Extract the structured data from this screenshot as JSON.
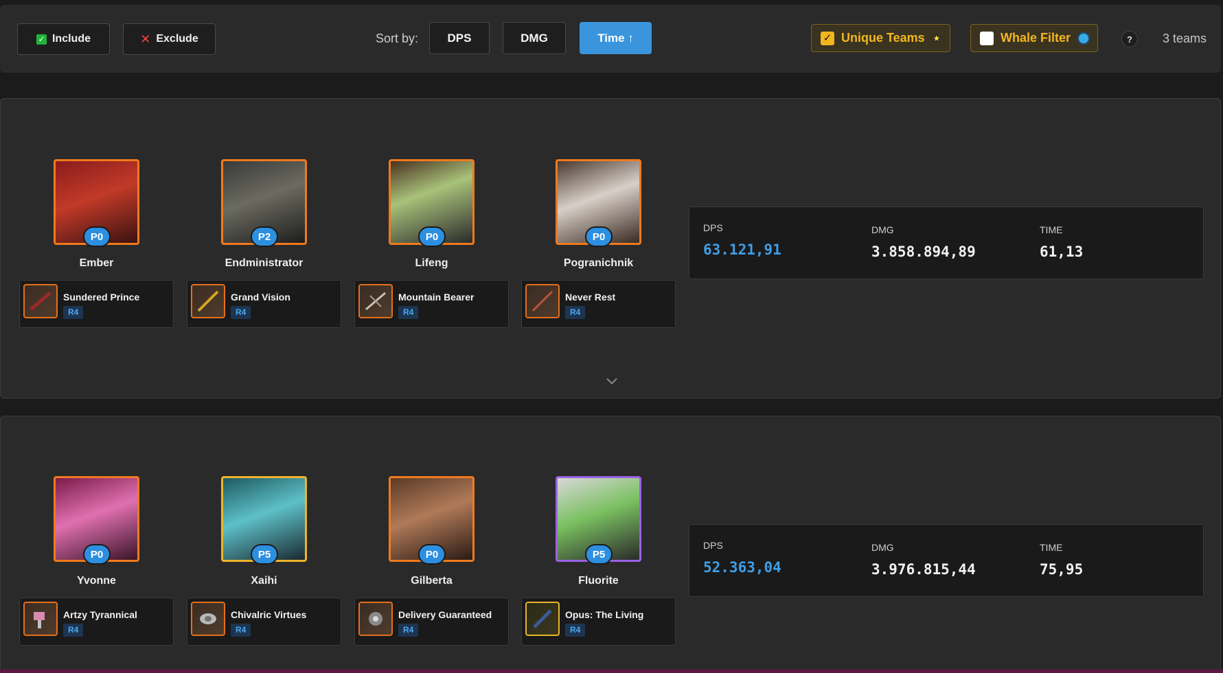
{
  "toolbar": {
    "include_label": "Include",
    "exclude_label": "Exclude",
    "sort_label": "Sort by:",
    "sort_options": [
      "DPS",
      "DMG",
      "Time ↑"
    ],
    "active_sort": "Time ↑",
    "unique_teams_label": "Unique Teams",
    "unique_teams_checked": true,
    "whale_filter_label": "Whale Filter",
    "whale_filter_checked": false,
    "help_label": "?",
    "team_count": "3 teams"
  },
  "colors": {
    "accent_blue": "#3a95dc",
    "accent_gold": "#f2b61e",
    "rarity_orange": "#f07a1e",
    "rarity_gold": "#efb42b",
    "rarity_purple": "#9a62e6"
  },
  "teams": [
    {
      "characters": [
        {
          "name": "Ember",
          "potential": "P0",
          "rarity": "orange",
          "weapon": "Sundered Prince",
          "weapon_rank": "R4",
          "weapon_rarity": "orange"
        },
        {
          "name": "Endministrator",
          "potential": "P2",
          "rarity": "orange",
          "weapon": "Grand Vision",
          "weapon_rank": "R4",
          "weapon_rarity": "orange"
        },
        {
          "name": "Lifeng",
          "potential": "P0",
          "rarity": "orange",
          "weapon": "Mountain Bearer",
          "weapon_rank": "R4",
          "weapon_rarity": "orange"
        },
        {
          "name": "Pogranichnik",
          "potential": "P0",
          "rarity": "orange",
          "weapon": "Never Rest",
          "weapon_rank": "R4",
          "weapon_rarity": "orange"
        }
      ],
      "stats": {
        "dps_label": "DPS",
        "dps": "63.121,91",
        "dmg_label": "DMG",
        "dmg": "3.858.894,89",
        "time_label": "TIME",
        "time": "61,13"
      }
    },
    {
      "characters": [
        {
          "name": "Yvonne",
          "potential": "P0",
          "rarity": "orange",
          "weapon": "Artzy Tyrannical",
          "weapon_rank": "R4",
          "weapon_rarity": "orange"
        },
        {
          "name": "Xaihi",
          "potential": "P5",
          "rarity": "gold",
          "weapon": "Chivalric Virtues",
          "weapon_rank": "R4",
          "weapon_rarity": "orange"
        },
        {
          "name": "Gilberta",
          "potential": "P0",
          "rarity": "orange",
          "weapon": "Delivery Guaranteed",
          "weapon_rank": "R4",
          "weapon_rarity": "orange"
        },
        {
          "name": "Fluorite",
          "potential": "P5",
          "rarity": "purple",
          "weapon": "Opus: The Living",
          "weapon_rank": "R4",
          "weapon_rarity": "gold"
        }
      ],
      "stats": {
        "dps_label": "DPS",
        "dps": "52.363,04",
        "dmg_label": "DMG",
        "dmg": "3.976.815,44",
        "time_label": "TIME",
        "time": "75,95"
      }
    }
  ]
}
